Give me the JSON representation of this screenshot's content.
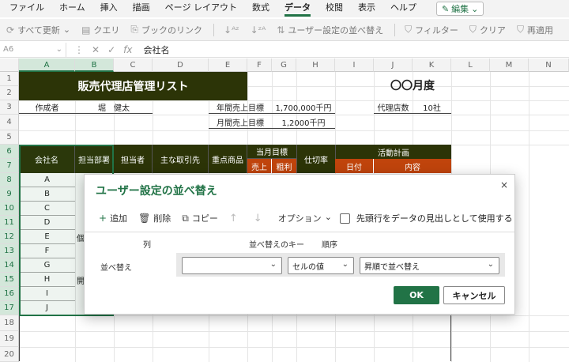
{
  "ribbon": {
    "tabs": [
      "ファイル",
      "ホーム",
      "挿入",
      "描画",
      "ページ レイアウト",
      "数式",
      "データ",
      "校閲",
      "表示",
      "ヘルプ"
    ],
    "active_tab": "データ",
    "edit_label": "編集"
  },
  "toolbar": {
    "refresh_all": "すべて更新",
    "query": "クエリ",
    "book_links": "ブックのリンク",
    "custom_sort": "ユーザー設定の並べ替え",
    "filter": "フィルター",
    "clear": "クリア",
    "reapply": "再適用"
  },
  "formula_bar": {
    "name_box": "A6",
    "fx": "fx",
    "content": "会社名"
  },
  "sheet": {
    "columns": [
      "A",
      "B",
      "C",
      "D",
      "E",
      "F",
      "G",
      "H",
      "I",
      "J",
      "K",
      "L",
      "M",
      "N"
    ],
    "rows": [
      "1",
      "2",
      "3",
      "4",
      "5",
      "6",
      "7",
      "8",
      "9",
      "10",
      "11",
      "12",
      "13",
      "14",
      "15",
      "16",
      "17",
      "18",
      "19",
      "20"
    ],
    "title": "販売代理店管理リスト",
    "month": "〇〇月度",
    "author_label": "作成者",
    "author_name": "堀　健太",
    "annual_target_label": "年間売上目標",
    "annual_target_value": "1,700,000千円",
    "monthly_target_label": "月間売上目標",
    "monthly_target_value": "1,2000千円",
    "agency_count_label": "代理店数",
    "agency_count_value": "10社",
    "headers": {
      "company": "会社名",
      "department": "担当部署",
      "person": "担当者",
      "main_client": "主な取引先",
      "product": "重点商品",
      "monthly_target": "当月目標",
      "sales": "売上",
      "profit": "粗利",
      "wholesale_rate": "仕切率",
      "activity_plan": "活動計画",
      "date": "日付",
      "content": "内容"
    },
    "companies": [
      "A",
      "B",
      "C",
      "D",
      "E",
      "F",
      "G",
      "H",
      "I",
      "J"
    ],
    "dept_partial": [
      "",
      "",
      "",
      "",
      "個",
      "",
      "",
      "開",
      "",
      ""
    ]
  },
  "dialog": {
    "title": "ユーザー設定の並べ替え",
    "close": "×",
    "add": "追加",
    "delete": "削除",
    "copy": "コピー",
    "move_up": "↑",
    "move_down": "↓",
    "options": "オプション",
    "header_checkbox_label": "先頭行をデータの見出しとして使用する",
    "col_header": "列",
    "key_header": "並べ替えのキー",
    "order_header": "順序",
    "row_label": "並べ替え",
    "column_value": "",
    "key_value": "セルの値",
    "order_value": "昇順で並べ替え",
    "ok": "OK",
    "cancel": "キャンセル"
  }
}
